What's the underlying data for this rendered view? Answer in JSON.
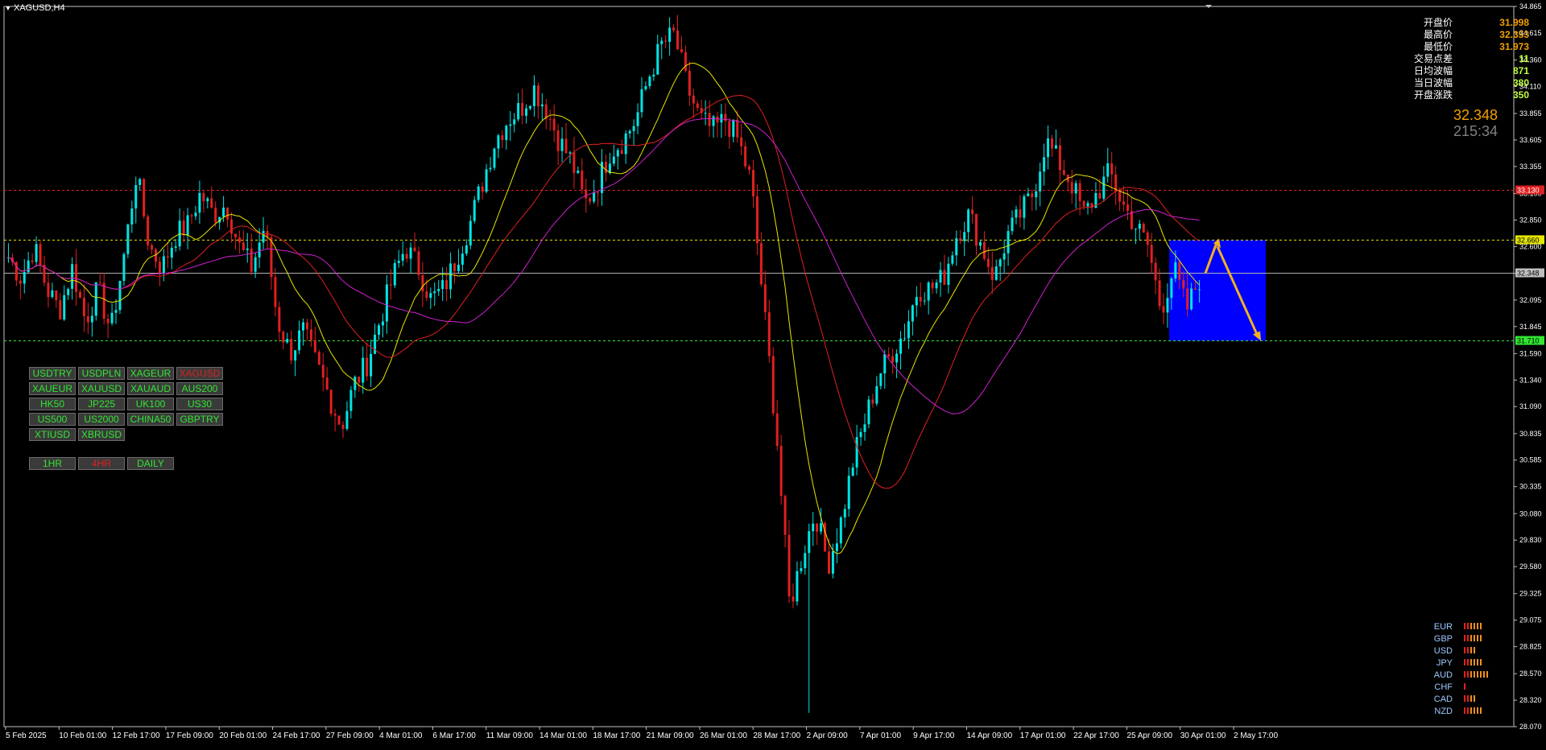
{
  "window": {
    "title": "XAGUSD,H4"
  },
  "chart_data": {
    "type": "candlestick",
    "symbol": "XAGUSD",
    "timeframe": "H4",
    "y_axis_ticks": [
      "34.865",
      "34.615",
      "34.360",
      "34.110",
      "33.855",
      "33.605",
      "33.355",
      "33.100",
      "32.850",
      "32.600",
      "32.348",
      "32.095",
      "31.845",
      "31.590",
      "31.340",
      "31.090",
      "30.835",
      "30.585",
      "30.335",
      "30.080",
      "29.830",
      "29.580",
      "29.325",
      "29.075",
      "28.825",
      "28.570",
      "28.320",
      "28.070"
    ],
    "ylim": [
      28.07,
      34.865
    ],
    "x_axis_labels": [
      "5 Feb 2025",
      "10 Feb 01:00",
      "12 Feb 17:00",
      "17 Feb 09:00",
      "20 Feb 01:00",
      "24 Feb 17:00",
      "27 Feb 09:00",
      "4 Mar 01:00",
      "6 Mar 17:00",
      "11 Mar 09:00",
      "14 Mar 01:00",
      "18 Mar 17:00",
      "21 Mar 09:00",
      "26 Mar 01:00",
      "28 Mar 17:00",
      "2 Apr 09:00",
      "7 Apr 01:00",
      "9 Apr 17:00",
      "14 Apr 09:00",
      "17 Apr 01:00",
      "22 Apr 17:00",
      "25 Apr 09:00",
      "30 Apr 01:00",
      "2 May 17:00"
    ],
    "horizontal_lines": [
      {
        "value": 33.13,
        "label": "33.130",
        "color": "#e02020"
      },
      {
        "value": 32.66,
        "label": "32.660",
        "color": "#e6e600"
      },
      {
        "value": 32.348,
        "label": "32.348",
        "color": "#b0b0b0"
      },
      {
        "value": 31.71,
        "label": "31.710",
        "color": "#32e632"
      }
    ],
    "price_path": [
      32.5,
      32.3,
      32.6,
      32.2,
      32.0,
      32.4,
      31.9,
      32.2,
      31.8,
      32.5,
      33.3,
      32.6,
      32.4,
      32.7,
      32.8,
      33.1,
      32.9,
      33.0,
      32.6,
      32.4,
      32.8,
      31.9,
      31.6,
      31.8,
      31.5,
      31.2,
      30.9,
      31.3,
      31.5,
      31.9,
      32.3,
      32.6,
      32.4,
      32.1,
      32.2,
      32.5,
      32.8,
      33.2,
      33.6,
      33.8,
      33.9,
      34.1,
      33.9,
      33.6,
      33.4,
      33.0,
      33.2,
      33.5,
      33.6,
      33.8,
      34.2,
      34.5,
      34.6,
      34.1,
      33.8,
      33.7,
      33.8,
      33.6,
      33.2,
      32.0,
      30.8,
      29.2,
      29.7,
      30.1,
      29.6,
      30.0,
      30.6,
      31.0,
      31.4,
      31.6,
      31.8,
      32.2,
      32.2,
      32.3,
      32.7,
      32.9,
      32.6,
      32.3,
      32.7,
      32.9,
      33.1,
      33.6,
      33.4,
      33.2,
      32.9,
      33.1,
      33.3,
      33.0,
      32.8,
      32.6,
      32.0,
      32.4,
      32.0,
      32.3
    ],
    "moving_averages": [
      {
        "name": "MA fast",
        "color": "#e6e600"
      },
      {
        "name": "MA mid",
        "color": "#e02020"
      },
      {
        "name": "MA slow",
        "color": "#d020d0"
      }
    ],
    "forecast_box": {
      "top": 32.66,
      "bottom": 31.71,
      "color": "#0000ff"
    },
    "forecast_arrows": [
      {
        "from": 32.348,
        "to": 32.66,
        "color": "#f0b020"
      },
      {
        "from": 32.66,
        "to": 31.71,
        "color": "#f0b020"
      }
    ],
    "min_low": 28.2,
    "max_high": 34.62
  },
  "info_panel": {
    "rows": [
      {
        "label": "开盘价",
        "value": "31.998",
        "color": "#f0a000"
      },
      {
        "label": "最高价",
        "value": "32.353",
        "color": "#f0a000"
      },
      {
        "label": "最低价",
        "value": "31.973",
        "color": "#f0a000"
      },
      {
        "label": "交易点差",
        "value": "11",
        "color": "#c0ff40"
      },
      {
        "label": "日均波幅",
        "value": "871",
        "color": "#c0ff40"
      },
      {
        "label": "当日波幅",
        "value": "380",
        "color": "#c0ff40"
      },
      {
        "label": "开盘涨跌",
        "value": "350",
        "color": "#c0ff40"
      }
    ],
    "current_price": "32.348",
    "countdown": "215:34"
  },
  "symbol_buttons": [
    {
      "label": "USDTRY",
      "active": false
    },
    {
      "label": "USDPLN",
      "active": false
    },
    {
      "label": "XAGEUR",
      "active": false
    },
    {
      "label": "XAGUSD",
      "active": true
    },
    {
      "label": "XAUEUR",
      "active": false
    },
    {
      "label": "XAUUSD",
      "active": false
    },
    {
      "label": "XAUAUD",
      "active": false
    },
    {
      "label": "AUS200",
      "active": false
    },
    {
      "label": "HK50",
      "active": false
    },
    {
      "label": "JP225",
      "active": false
    },
    {
      "label": "UK100",
      "active": false
    },
    {
      "label": "US30",
      "active": false
    },
    {
      "label": "US500",
      "active": false
    },
    {
      "label": "US2000",
      "active": false
    },
    {
      "label": "CHINA50",
      "active": false
    },
    {
      "label": "GBPTRY",
      "active": false
    },
    {
      "label": "XTIUSD",
      "active": false
    },
    {
      "label": "XBRUSD",
      "active": false
    }
  ],
  "timeframe_buttons": [
    {
      "label": "1HR",
      "active": false
    },
    {
      "label": "4HR",
      "active": true
    },
    {
      "label": "DAILY",
      "active": false
    }
  ],
  "currency_strength": [
    {
      "label": "EUR",
      "strength": 6
    },
    {
      "label": "GBP",
      "strength": 6
    },
    {
      "label": "USD",
      "strength": 4
    },
    {
      "label": "JPY",
      "strength": 6
    },
    {
      "label": "AUD",
      "strength": 8
    },
    {
      "label": "CHF",
      "strength": 1
    },
    {
      "label": "CAD",
      "strength": 4
    },
    {
      "label": "NZD",
      "strength": 6
    }
  ]
}
